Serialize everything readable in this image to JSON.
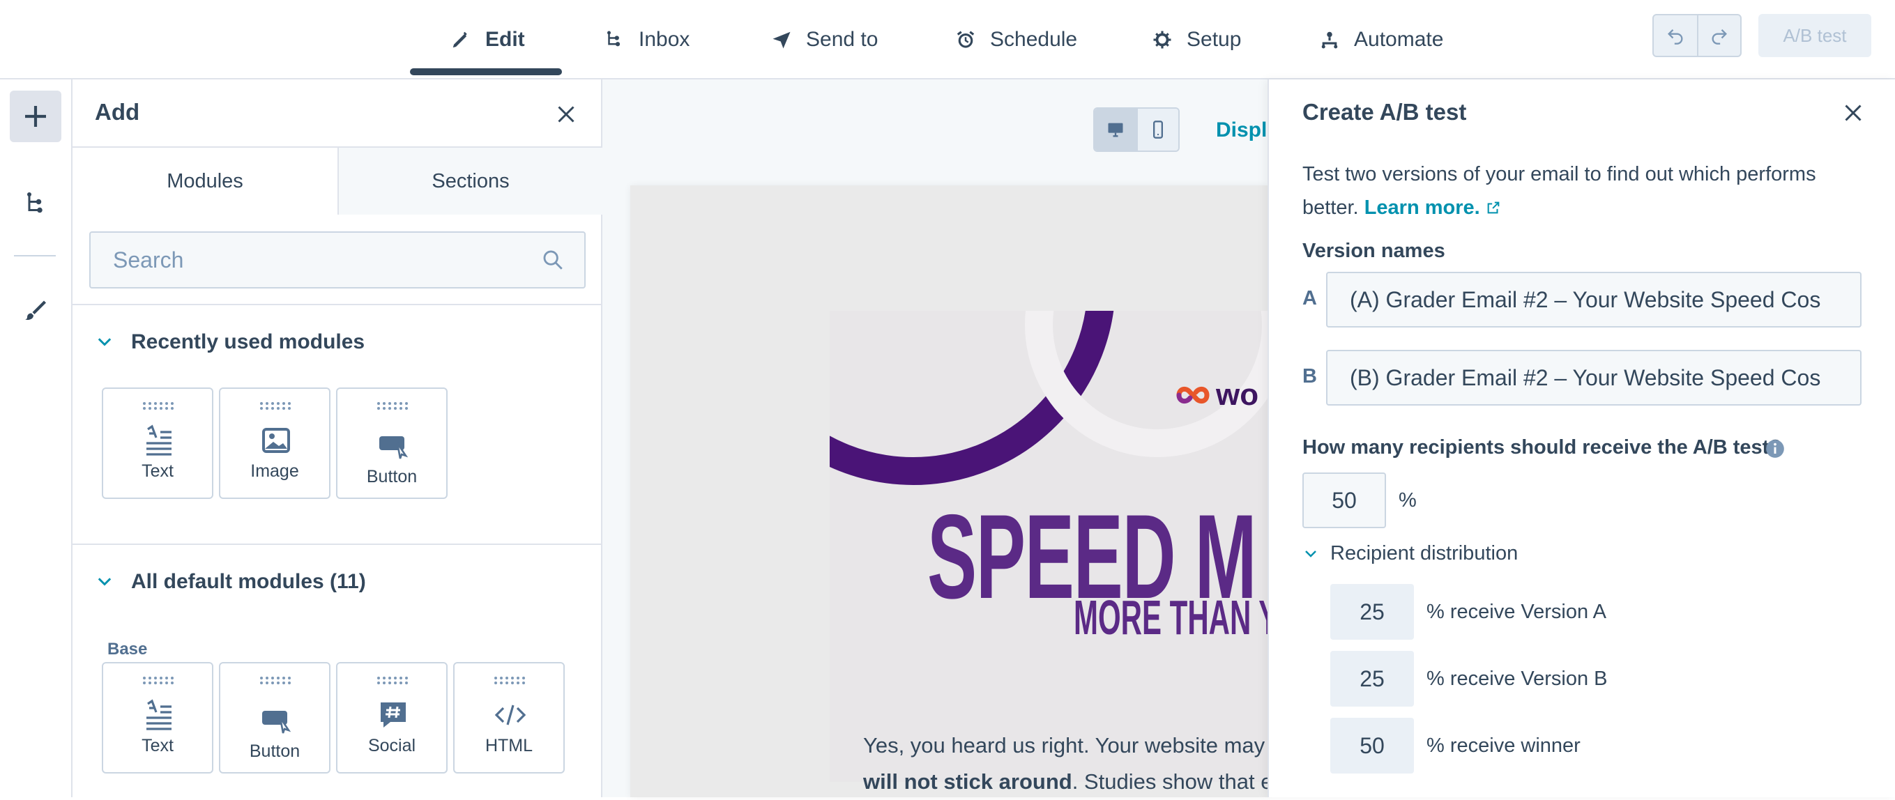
{
  "nav": {
    "tabs": [
      {
        "label": "Edit",
        "icon": "pencil-icon"
      },
      {
        "label": "Inbox",
        "icon": "inbox-icon"
      },
      {
        "label": "Send to",
        "icon": "send-icon"
      },
      {
        "label": "Schedule",
        "icon": "alarm-clock-icon"
      },
      {
        "label": "Setup",
        "icon": "gear-icon"
      },
      {
        "label": "Automate",
        "icon": "automation-icon"
      }
    ],
    "ab_test_button": "A/B test"
  },
  "add_panel": {
    "title": "Add",
    "tabs": [
      "Modules",
      "Sections"
    ],
    "search_placeholder": "Search",
    "recent": {
      "title": "Recently used modules",
      "modules": [
        "Text",
        "Image",
        "Button"
      ]
    },
    "all_default": {
      "title": "All default modules (11)",
      "group_label": "Base",
      "modules": [
        "Text",
        "Button",
        "Social",
        "HTML"
      ]
    }
  },
  "canvas": {
    "display_link": "Displ",
    "email": {
      "brand": "wo",
      "headline": "SPEED M",
      "subheadline": "MORE THAN Y",
      "body_line1": "Yes, you heard us right. Your website may lo",
      "body_line2_bold": "will not stick around",
      "body_line2_rest": ". Studies show that ev"
    }
  },
  "ab_panel": {
    "title": "Create A/B test",
    "description": "Test two versions of your email to find out which performs better.",
    "learn_more": "Learn more.",
    "version_names_label": "Version names",
    "version_a_letter": "A",
    "version_a_value": "(A) Grader Email #2 – Your Website Speed Cos",
    "version_b_letter": "B",
    "version_b_value": "(B) Grader Email #2 – Your Website Speed Cos",
    "recipients_question": "How many recipients should receive the A/B test?",
    "recipients_percent": "50",
    "percent_sign": "%",
    "distribution_title": "Recipient distribution",
    "distribution": [
      {
        "value": "25",
        "label": "% receive Version A"
      },
      {
        "value": "25",
        "label": "% receive Version B"
      },
      {
        "value": "50",
        "label": "% receive winner"
      }
    ]
  },
  "colors": {
    "text": "#33475b",
    "link": "#0091ae",
    "border": "#cbd6e2",
    "brand_purple": "#5b2a86"
  }
}
